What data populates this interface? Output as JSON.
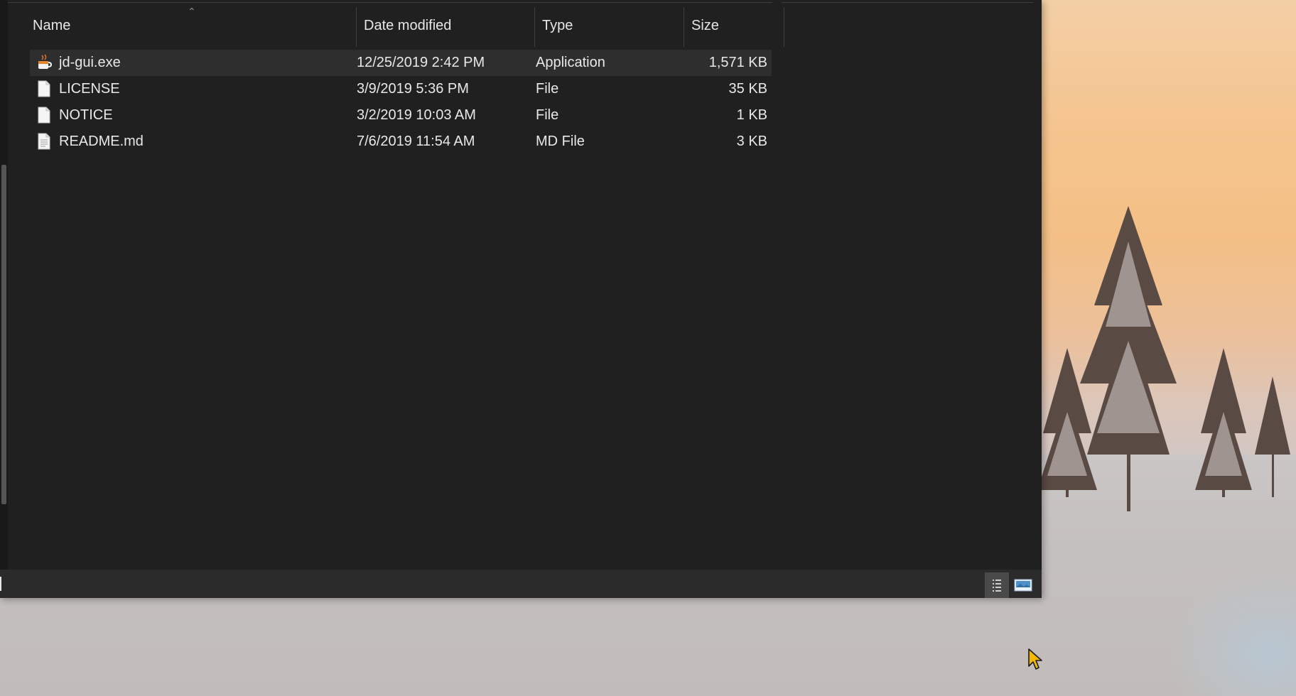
{
  "columns": {
    "name": "Name",
    "date_modified": "Date modified",
    "type": "Type",
    "size": "Size"
  },
  "sort": {
    "column": "name",
    "direction": "ascending",
    "icon": "sort-up-icon"
  },
  "files": [
    {
      "name": "jd-gui.exe",
      "date": "12/25/2019 2:42 PM",
      "type": "Application",
      "size": "1,571 KB",
      "icon": "java-app-icon",
      "selected": true
    },
    {
      "name": "LICENSE",
      "date": "3/9/2019 5:36 PM",
      "type": "File",
      "size": "35 KB",
      "icon": "file-icon",
      "selected": false
    },
    {
      "name": "NOTICE",
      "date": "3/2/2019 10:03 AM",
      "type": "File",
      "size": "1 KB",
      "icon": "file-icon",
      "selected": false
    },
    {
      "name": "README.md",
      "date": "7/6/2019 11:54 AM",
      "type": "MD File",
      "size": "3 KB",
      "icon": "text-file-icon",
      "selected": false
    }
  ],
  "status_bar": {
    "view_buttons": [
      "details-view-icon",
      "large-icons-view-icon"
    ],
    "active_view": "details"
  },
  "colors": {
    "window_bg": "#202020",
    "selected_row": "#2e2e2e",
    "text": "#e8e8e8",
    "status_bar": "#2b2b2b"
  }
}
